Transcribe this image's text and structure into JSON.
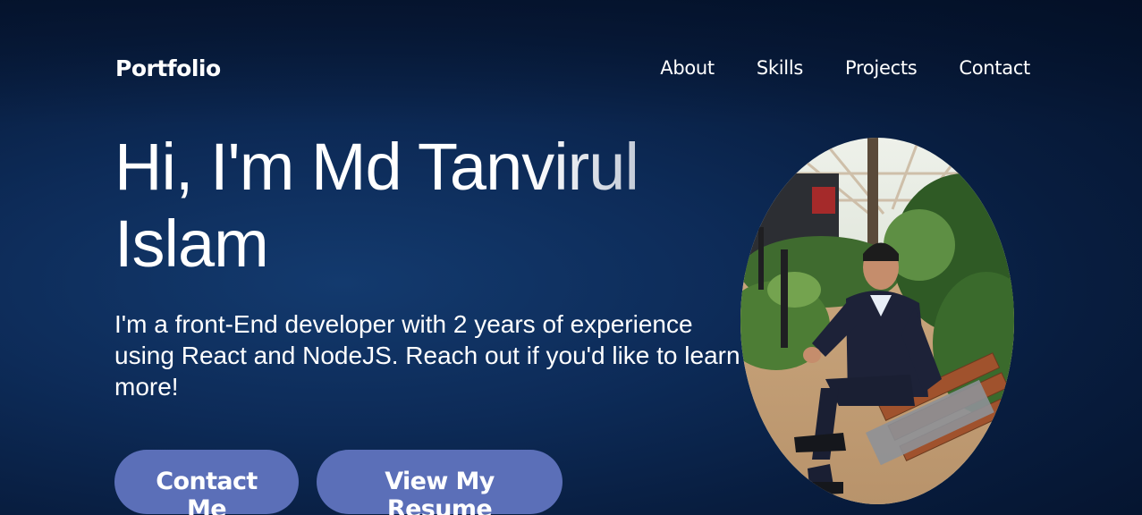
{
  "nav": {
    "brand": "Portfolio",
    "links": [
      "About",
      "Skills",
      "Projects",
      "Contact"
    ]
  },
  "hero": {
    "title": "Hi, I'm Md Tanvirul Islam",
    "description": "I'm a front-End developer with 2 years of experience using React and NodeJS. Reach out if you'd like to learn more!",
    "contact_button": "Contact Me",
    "resume_button": "View My Resume"
  },
  "photo": {
    "icon": "profile-photo"
  },
  "colors": {
    "background_dark": "#04122b",
    "background_mid": "#0d2b58",
    "button": "#5b6fb8",
    "text": "#ffffff"
  }
}
